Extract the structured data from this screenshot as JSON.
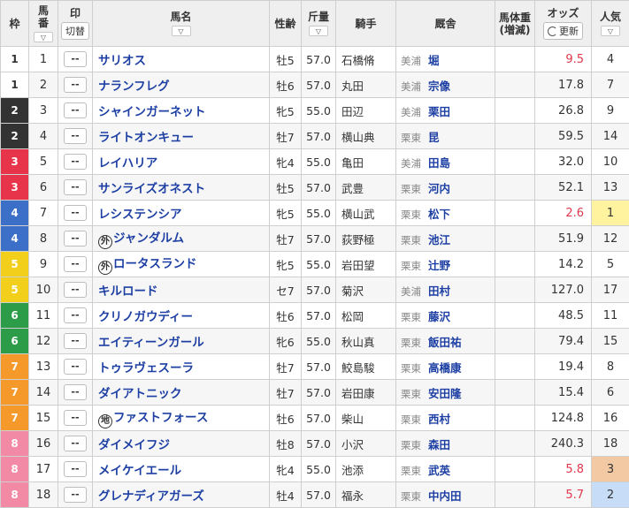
{
  "headers": {
    "waku": "枠",
    "umaban_1": "馬",
    "umaban_2": "番",
    "mark": "印",
    "mark_toggle": "切替",
    "horse": "馬名",
    "sexage": "性齢",
    "weight": "斤量",
    "jockey": "騎手",
    "stable": "厩舎",
    "bodyw_1": "馬体重",
    "bodyw_2": "(増減)",
    "odds": "オッズ",
    "refresh": "更新",
    "pop": "人気",
    "sort_icon": "chevron-down-icon"
  },
  "mark_default": "--",
  "rows": [
    {
      "waku": "1",
      "num": "1",
      "ext": "",
      "horse": "サリオス",
      "sexage": "牡5",
      "weight": "57.0",
      "jockey": "石橋脩",
      "region": "美浦",
      "trainer": "堀",
      "odds": "9.5",
      "hot": true,
      "pop": "4"
    },
    {
      "waku": "1",
      "num": "2",
      "ext": "",
      "horse": "ナランフレグ",
      "sexage": "牡6",
      "weight": "57.0",
      "jockey": "丸田",
      "region": "美浦",
      "trainer": "宗像",
      "odds": "17.8",
      "hot": false,
      "pop": "7"
    },
    {
      "waku": "2",
      "num": "3",
      "ext": "",
      "horse": "シャインガーネット",
      "sexage": "牝5",
      "weight": "55.0",
      "jockey": "田辺",
      "region": "美浦",
      "trainer": "栗田",
      "odds": "26.8",
      "hot": false,
      "pop": "9"
    },
    {
      "waku": "2",
      "num": "4",
      "ext": "",
      "horse": "ライトオンキュー",
      "sexage": "牡7",
      "weight": "57.0",
      "jockey": "横山典",
      "region": "栗東",
      "trainer": "昆",
      "odds": "59.5",
      "hot": false,
      "pop": "14"
    },
    {
      "waku": "3",
      "num": "5",
      "ext": "",
      "horse": "レイハリア",
      "sexage": "牝4",
      "weight": "55.0",
      "jockey": "亀田",
      "region": "美浦",
      "trainer": "田島",
      "odds": "32.0",
      "hot": false,
      "pop": "10"
    },
    {
      "waku": "3",
      "num": "6",
      "ext": "",
      "horse": "サンライズオネスト",
      "sexage": "牡5",
      "weight": "57.0",
      "jockey": "武豊",
      "region": "栗東",
      "trainer": "河内",
      "odds": "52.1",
      "hot": false,
      "pop": "13"
    },
    {
      "waku": "4",
      "num": "7",
      "ext": "",
      "horse": "レシステンシア",
      "sexage": "牝5",
      "weight": "55.0",
      "jockey": "横山武",
      "region": "栗東",
      "trainer": "松下",
      "odds": "2.6",
      "hot": true,
      "pop": "1"
    },
    {
      "waku": "4",
      "num": "8",
      "ext": "外",
      "horse": "ジャンダルム",
      "sexage": "牡7",
      "weight": "57.0",
      "jockey": "荻野極",
      "region": "栗東",
      "trainer": "池江",
      "odds": "51.9",
      "hot": false,
      "pop": "12"
    },
    {
      "waku": "5",
      "num": "9",
      "ext": "外",
      "horse": "ロータスランド",
      "sexage": "牝5",
      "weight": "55.0",
      "jockey": "岩田望",
      "region": "栗東",
      "trainer": "辻野",
      "odds": "14.2",
      "hot": false,
      "pop": "5"
    },
    {
      "waku": "5",
      "num": "10",
      "ext": "",
      "horse": "キルロード",
      "sexage": "セ7",
      "weight": "57.0",
      "jockey": "菊沢",
      "region": "美浦",
      "trainer": "田村",
      "odds": "127.0",
      "hot": false,
      "pop": "17"
    },
    {
      "waku": "6",
      "num": "11",
      "ext": "",
      "horse": "クリノガウディー",
      "sexage": "牡6",
      "weight": "57.0",
      "jockey": "松岡",
      "region": "栗東",
      "trainer": "藤沢",
      "odds": "48.5",
      "hot": false,
      "pop": "11"
    },
    {
      "waku": "6",
      "num": "12",
      "ext": "",
      "horse": "エイティーンガール",
      "sexage": "牝6",
      "weight": "55.0",
      "jockey": "秋山真",
      "region": "栗東",
      "trainer": "飯田祐",
      "odds": "79.4",
      "hot": false,
      "pop": "15"
    },
    {
      "waku": "7",
      "num": "13",
      "ext": "",
      "horse": "トゥラヴェスーラ",
      "sexage": "牡7",
      "weight": "57.0",
      "jockey": "鮫島駿",
      "region": "栗東",
      "trainer": "高橋康",
      "odds": "19.4",
      "hot": false,
      "pop": "8"
    },
    {
      "waku": "7",
      "num": "14",
      "ext": "",
      "horse": "ダイアトニック",
      "sexage": "牡7",
      "weight": "57.0",
      "jockey": "岩田康",
      "region": "栗東",
      "trainer": "安田隆",
      "odds": "15.4",
      "hot": false,
      "pop": "6"
    },
    {
      "waku": "7",
      "num": "15",
      "ext": "地",
      "horse": "ファストフォース",
      "sexage": "牡6",
      "weight": "57.0",
      "jockey": "柴山",
      "region": "栗東",
      "trainer": "西村",
      "odds": "124.8",
      "hot": false,
      "pop": "16"
    },
    {
      "waku": "8",
      "num": "16",
      "ext": "",
      "horse": "ダイメイフジ",
      "sexage": "牡8",
      "weight": "57.0",
      "jockey": "小沢",
      "region": "栗東",
      "trainer": "森田",
      "odds": "240.3",
      "hot": false,
      "pop": "18"
    },
    {
      "waku": "8",
      "num": "17",
      "ext": "",
      "horse": "メイケイエール",
      "sexage": "牝4",
      "weight": "55.0",
      "jockey": "池添",
      "region": "栗東",
      "trainer": "武英",
      "odds": "5.8",
      "hot": true,
      "pop": "3"
    },
    {
      "waku": "8",
      "num": "18",
      "ext": "",
      "horse": "グレナディアガーズ",
      "sexage": "牡4",
      "weight": "57.0",
      "jockey": "福永",
      "region": "栗東",
      "trainer": "中内田",
      "odds": "5.7",
      "hot": true,
      "pop": "2"
    }
  ]
}
